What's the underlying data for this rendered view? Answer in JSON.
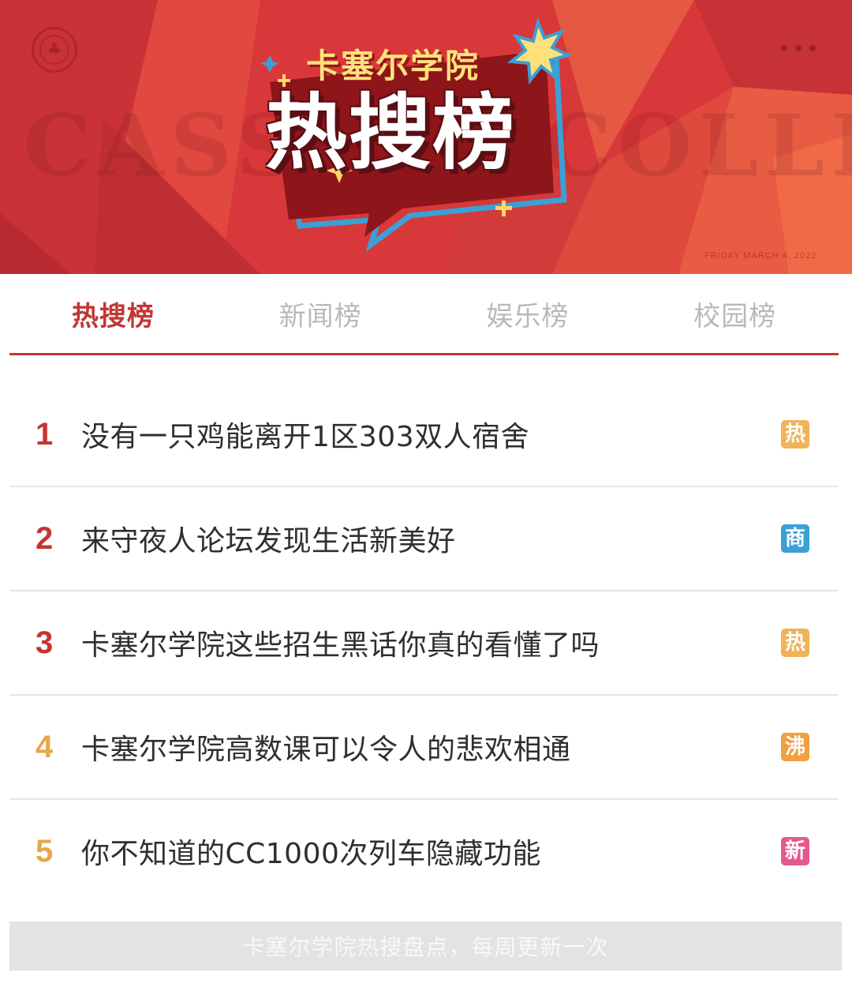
{
  "header": {
    "brand_sub": "卡塞尔学院",
    "brand_title": "热搜榜",
    "watermark": "CASSELL COLLEGE",
    "date": "FRIDAY MARCH 4, 2022",
    "logo_icon": "seal-tree-icon",
    "more_icon": "more-dots-icon",
    "colors": {
      "banner": "#d8383a",
      "accent_yellow": "#fde27a",
      "accent_blue": "#3ba0d6"
    }
  },
  "tabs": [
    {
      "label": "热搜榜",
      "active": true
    },
    {
      "label": "新闻榜",
      "active": false
    },
    {
      "label": "娱乐榜",
      "active": false
    },
    {
      "label": "校园榜",
      "active": false
    }
  ],
  "list": [
    {
      "rank": "1",
      "rank_color": "#c33535",
      "title": "没有一只鸡能离开1区303双人宿舍",
      "badge": "热",
      "badge_color": "#f0b35a"
    },
    {
      "rank": "2",
      "rank_color": "#c33535",
      "title": "来守夜人论坛发现生活新美好",
      "badge": "商",
      "badge_color": "#3ba0d6"
    },
    {
      "rank": "3",
      "rank_color": "#c33535",
      "title": "卡塞尔学院这些招生黑话你真的看懂了吗",
      "badge": "热",
      "badge_color": "#f0b35a"
    },
    {
      "rank": "4",
      "rank_color": "#e7a84a",
      "title": "卡塞尔学院高数课可以令人的悲欢相通",
      "badge": "沸",
      "badge_color": "#f0a040"
    },
    {
      "rank": "5",
      "rank_color": "#e7a84a",
      "title": "你不知道的CC1000次列车隐藏功能",
      "badge": "新",
      "badge_color": "#e45a8e"
    }
  ],
  "footer": {
    "text": "卡塞尔学院热搜盘点，每周更新一次"
  }
}
